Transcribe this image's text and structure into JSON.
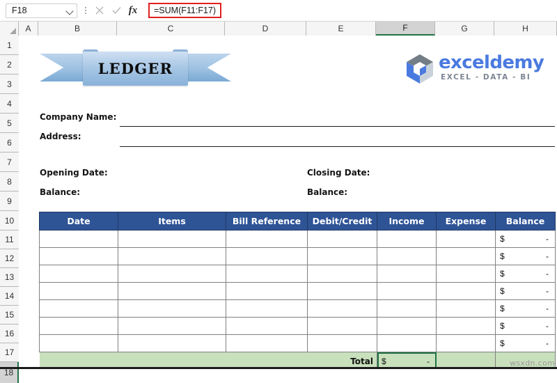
{
  "formula_bar": {
    "name_box_value": "F18",
    "name_box_icon": "chevron-down-icon",
    "more_icon": "kebab-menu-icon",
    "cancel_icon": "cancel-x-icon",
    "confirm_icon": "confirm-check-icon",
    "function_icon": "fx-icon",
    "formula_value": "=SUM(F11:F17)",
    "highlight_color": "#e02020"
  },
  "grid": {
    "columns": [
      "A",
      "B",
      "C",
      "D",
      "E",
      "F",
      "G",
      "H"
    ],
    "selected_column": "F",
    "rows": [
      "1",
      "2",
      "3",
      "4",
      "5",
      "6",
      "7",
      "8",
      "9",
      "10",
      "11",
      "12",
      "13",
      "14",
      "15",
      "16",
      "17",
      "18"
    ],
    "selected_row": "18",
    "selection_color": "#217346"
  },
  "banner": {
    "title": "LEDGER",
    "color": "#9dc1e2"
  },
  "logo": {
    "name": "exceldemy",
    "tagline": "EXCEL - DATA - BI",
    "mark": "hexagon-cube-icon",
    "text_color": "#4a7ae0",
    "tag_color": "#7d8794"
  },
  "form": {
    "company_name_label": "Company Name:",
    "address_label": "Address:",
    "opening_date_label": "Opening Date:",
    "opening_balance_label": "Balance:",
    "closing_date_label": "Closing Date:",
    "closing_balance_label": "Balance:",
    "company_name_value": "",
    "address_value": "",
    "opening_date_value": "",
    "opening_balance_value": "",
    "closing_date_value": "",
    "closing_balance_value": ""
  },
  "table": {
    "header_color": "#2e5496",
    "total_row_color": "#c8e0bc",
    "headers": [
      "Date",
      "Items",
      "Bill Reference",
      "Debit/Credit",
      "Income",
      "Expense",
      "Balance"
    ],
    "rows": [
      {
        "date": "",
        "items": "",
        "bill_reference": "",
        "debit_credit": "",
        "income": "",
        "expense": "",
        "balance_symbol": "$",
        "balance_value": "-"
      },
      {
        "date": "",
        "items": "",
        "bill_reference": "",
        "debit_credit": "",
        "income": "",
        "expense": "",
        "balance_symbol": "$",
        "balance_value": "-"
      },
      {
        "date": "",
        "items": "",
        "bill_reference": "",
        "debit_credit": "",
        "income": "",
        "expense": "",
        "balance_symbol": "$",
        "balance_value": "-"
      },
      {
        "date": "",
        "items": "",
        "bill_reference": "",
        "debit_credit": "",
        "income": "",
        "expense": "",
        "balance_symbol": "$",
        "balance_value": "-"
      },
      {
        "date": "",
        "items": "",
        "bill_reference": "",
        "debit_credit": "",
        "income": "",
        "expense": "",
        "balance_symbol": "$",
        "balance_value": "-"
      },
      {
        "date": "",
        "items": "",
        "bill_reference": "",
        "debit_credit": "",
        "income": "",
        "expense": "",
        "balance_symbol": "$",
        "balance_value": "-"
      },
      {
        "date": "",
        "items": "",
        "bill_reference": "",
        "debit_credit": "",
        "income": "",
        "expense": "",
        "balance_symbol": "$",
        "balance_value": "-"
      }
    ],
    "total": {
      "label": "Total",
      "income_symbol": "$",
      "income_value": "-",
      "expense_value": "",
      "balance_value": ""
    }
  },
  "watermark": "wsxdn.com"
}
